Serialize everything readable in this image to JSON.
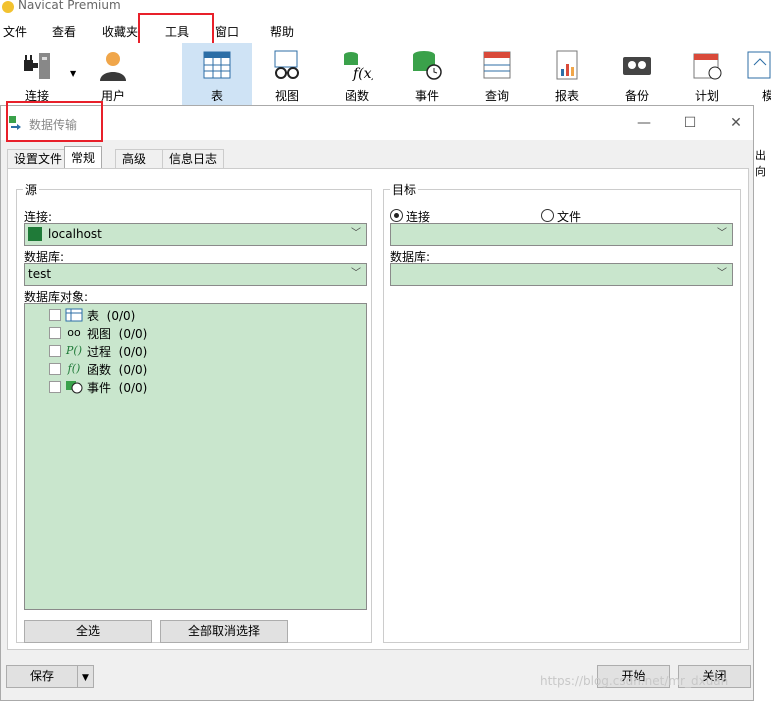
{
  "app": {
    "title": "Navicat Premium"
  },
  "menu": [
    "文件",
    "查看",
    "收藏夹",
    "工具",
    "窗口",
    "帮助"
  ],
  "toolbar": [
    {
      "label": "连接",
      "icon": "plug-icon"
    },
    {
      "label": "用户",
      "icon": "user-icon"
    },
    {
      "label": "表",
      "icon": "table-icon"
    },
    {
      "label": "视图",
      "icon": "glasses-icon"
    },
    {
      "label": "函数",
      "icon": "function-icon"
    },
    {
      "label": "事件",
      "icon": "event-icon"
    },
    {
      "label": "查询",
      "icon": "query-icon"
    },
    {
      "label": "报表",
      "icon": "report-icon"
    },
    {
      "label": "备份",
      "icon": "backup-icon"
    },
    {
      "label": "计划",
      "icon": "calendar-icon"
    },
    {
      "label": "模",
      "icon": "model-icon"
    }
  ],
  "background": {
    "right_text": "出向"
  },
  "dialog": {
    "title": "数据传输",
    "tabs": [
      "设置文件",
      "常规",
      "高级",
      "信息日志"
    ],
    "active_tab": "常规",
    "source": {
      "group_title": "源",
      "connection_label": "连接:",
      "connection_value": "localhost",
      "database_label": "数据库:",
      "database_value": "test",
      "objects_label": "数据库对象:",
      "objects": [
        {
          "label": "表",
          "count": "(0/0)",
          "icon": "table-icon"
        },
        {
          "label": "视图",
          "count": "(0/0)",
          "icon": "glasses-icon"
        },
        {
          "label": "过程",
          "count": "(0/0)",
          "icon": "procedure-icon"
        },
        {
          "label": "函数",
          "count": "(0/0)",
          "icon": "function-icon"
        },
        {
          "label": "事件",
          "count": "(0/0)",
          "icon": "event-icon"
        }
      ],
      "select_all": "全选",
      "deselect_all": "全部取消选择"
    },
    "target": {
      "group_title": "目标",
      "radio_connection": "连接",
      "radio_file": "文件",
      "connection_value": "",
      "database_label": "数据库:",
      "database_value": ""
    },
    "buttons": {
      "save": "保存",
      "start": "开始",
      "close": "关闭"
    }
  },
  "watermark": "https://blog.csdn.net/mr_dxuan",
  "colors": {
    "highlight_red": "#e8202a",
    "field_green": "#c9e6cd",
    "active_tool": "#cfe3f5"
  }
}
